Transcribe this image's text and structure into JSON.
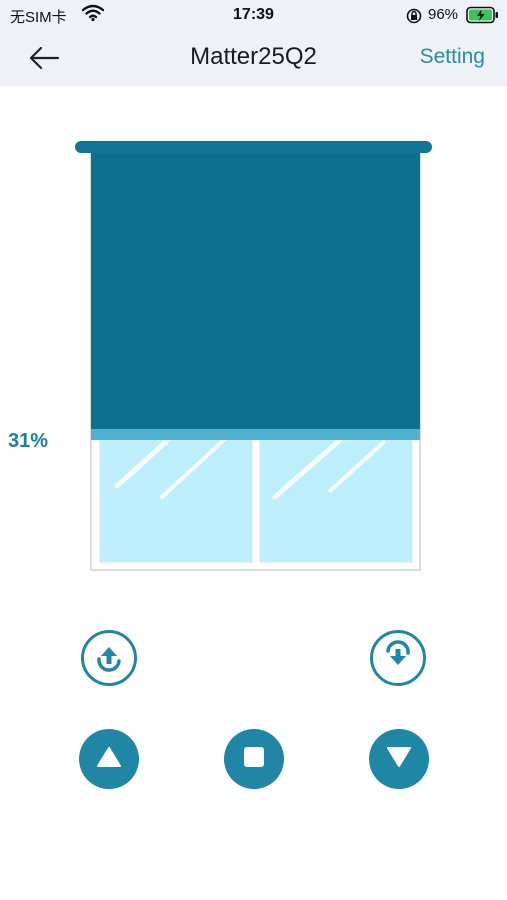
{
  "status": {
    "carrier": "无SIM卡",
    "time": "17:39",
    "battery": "96%"
  },
  "nav": {
    "back_icon": "arrow-left-icon",
    "title": "Matter25Q2",
    "setting": "Setting"
  },
  "curtain": {
    "position_label": "31%",
    "position_fraction": 0.31
  },
  "controls": {
    "rotate_up_icon": "rotate-up-icon",
    "rotate_down_icon": "rotate-down-icon",
    "open_icon": "triangle-up-icon",
    "stop_icon": "square-stop-icon",
    "close_icon": "triangle-down-icon"
  },
  "colors": {
    "accent": "#1f86a6",
    "curtain": "#0e7090",
    "window_glass": "#bdeefb"
  }
}
